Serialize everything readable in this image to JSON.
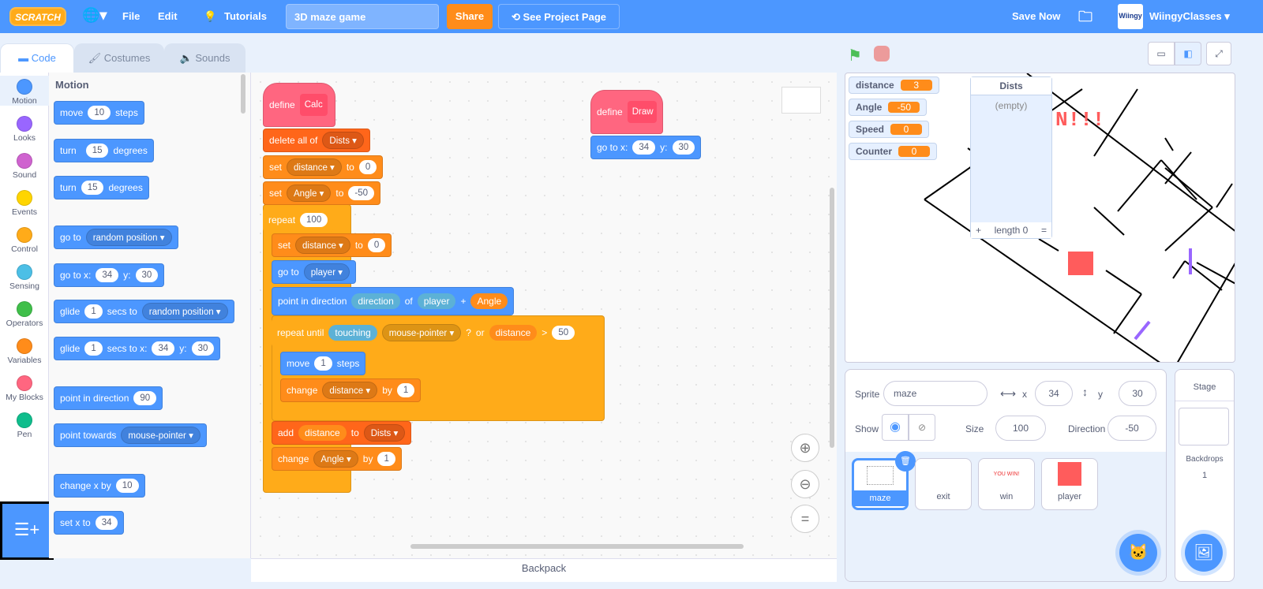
{
  "topbar": {
    "logo": "SCRATCH",
    "language_icon": "globe-icon",
    "file": "File",
    "edit": "Edit",
    "tutorials": "Tutorials",
    "project_title": "3D maze game",
    "share": "Share",
    "see_project": "See Project Page",
    "save_now": "Save Now",
    "user": "WiingyClasses",
    "avatar_text": "Wiingy"
  },
  "tabs": {
    "code": "Code",
    "costumes": "Costumes",
    "sounds": "Sounds"
  },
  "categories": [
    {
      "label": "Motion",
      "color": "#4c97ff"
    },
    {
      "label": "Looks",
      "color": "#9966ff"
    },
    {
      "label": "Sound",
      "color": "#cf63cf"
    },
    {
      "label": "Events",
      "color": "#ffd500"
    },
    {
      "label": "Control",
      "color": "#ffab19"
    },
    {
      "label": "Sensing",
      "color": "#4cbfe6"
    },
    {
      "label": "Operators",
      "color": "#40bf4a"
    },
    {
      "label": "Variables",
      "color": "#ff8c1a"
    },
    {
      "label": "My Blocks",
      "color": "#ff6680"
    },
    {
      "label": "Pen",
      "color": "#0fbd8c"
    }
  ],
  "palette": {
    "heading": "Motion",
    "move": [
      "move",
      "10",
      "steps"
    ],
    "turn_right": [
      "turn",
      "15",
      "degrees"
    ],
    "turn_left": [
      "turn",
      "15",
      "degrees"
    ],
    "goto": [
      "go to",
      "random position"
    ],
    "gotoxy": [
      "go to x:",
      "34",
      "y:",
      "30"
    ],
    "glide": [
      "glide",
      "1",
      "secs to",
      "random position"
    ],
    "glidexy": [
      "glide",
      "1",
      "secs to x:",
      "34",
      "y:",
      "30"
    ],
    "point_dir": [
      "point in direction",
      "90"
    ],
    "point_towards": [
      "point towards",
      "mouse-pointer"
    ],
    "change_x": [
      "change x by",
      "10"
    ],
    "set_x": [
      "set x to",
      "34"
    ]
  },
  "script1": {
    "define": "define",
    "name": "Calc",
    "delete_all": "delete all of",
    "list": "Dists",
    "set1": [
      "set",
      "distance",
      "to",
      "0"
    ],
    "set2": [
      "set",
      "Angle",
      "to",
      "-50"
    ],
    "repeat": [
      "repeat",
      "100"
    ],
    "set3": [
      "set",
      "distance",
      "to",
      "0"
    ],
    "goto": [
      "go to",
      "player"
    ],
    "point": [
      "point in direction",
      "direction",
      "of",
      "player",
      "+",
      "Angle"
    ],
    "repeat_until": [
      "repeat until",
      "touching",
      "mouse-pointer",
      "?",
      "or",
      "distance",
      ">",
      "50"
    ],
    "move": [
      "move",
      "1",
      "steps"
    ],
    "change1": [
      "change",
      "distance",
      "by",
      "1"
    ],
    "add": [
      "add",
      "distance",
      "to",
      "Dists"
    ],
    "change2": [
      "change",
      "Angle",
      "by",
      "1"
    ]
  },
  "script2": {
    "define": "define",
    "name": "Draw",
    "gotoxy": [
      "go to x:",
      "34",
      "y:",
      "30"
    ]
  },
  "backpack": "Backpack",
  "stage": {
    "monitors": [
      {
        "name": "distance",
        "value": "3"
      },
      {
        "name": "Angle",
        "value": "-50"
      },
      {
        "name": "Speed",
        "value": "0"
      },
      {
        "name": "Counter",
        "value": "0"
      }
    ],
    "list_monitor": {
      "title": "Dists",
      "empty": "(empty)",
      "add": "+",
      "length": "length 0",
      "resize": "="
    }
  },
  "sprite_info": {
    "sprite_label": "Sprite",
    "sprite_name": "maze",
    "x_label": "x",
    "x": "34",
    "y_label": "y",
    "y": "30",
    "show_label": "Show",
    "size_label": "Size",
    "size": "100",
    "direction_label": "Direction",
    "direction": "-50"
  },
  "sprites": [
    {
      "name": "maze",
      "selected": true
    },
    {
      "name": "exit"
    },
    {
      "name": "win",
      "thumb_text": "YOU WIN!"
    },
    {
      "name": "player",
      "color": "#ff5c5c"
    }
  ],
  "stage_pane": {
    "title": "Stage",
    "backdrops_label": "Backdrops",
    "backdrops": "1"
  }
}
